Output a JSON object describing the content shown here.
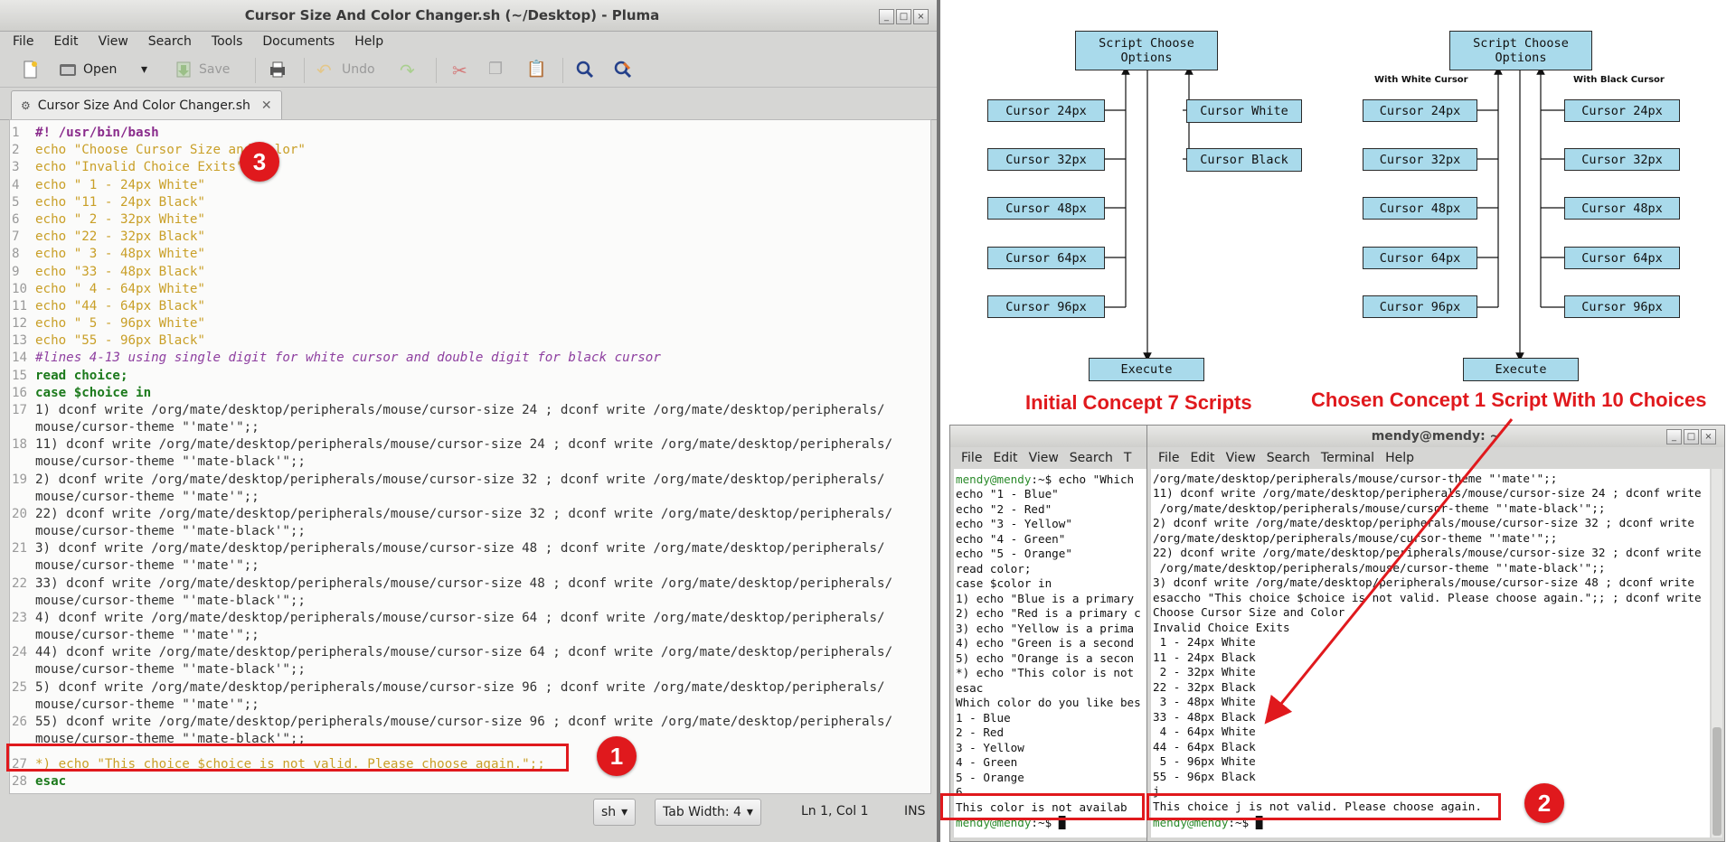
{
  "editor": {
    "title": "Cursor Size And Color Changer.sh (~/Desktop) - Pluma",
    "menu": [
      "File",
      "Edit",
      "View",
      "Search",
      "Tools",
      "Documents",
      "Help"
    ],
    "toolbar": {
      "open": "Open",
      "save": "Save",
      "undo": "Undo"
    },
    "tab_label": "Cursor Size And Color Changer.sh",
    "lines": [
      {
        "n": "1",
        "t": "#! /usr/bin/bash"
      },
      {
        "n": "2",
        "t": "echo \"Choose Cursor Size and Color\""
      },
      {
        "n": "3",
        "t": "echo \"Invalid Choice Exits\""
      },
      {
        "n": "4",
        "t": "echo \" 1 - 24px White\""
      },
      {
        "n": "5",
        "t": "echo \"11 - 24px Black\""
      },
      {
        "n": "6",
        "t": "echo \" 2 - 32px White\""
      },
      {
        "n": "7",
        "t": "echo \"22 - 32px Black\""
      },
      {
        "n": "8",
        "t": "echo \" 3 - 48px White\""
      },
      {
        "n": "9",
        "t": "echo \"33 - 48px Black\""
      },
      {
        "n": "10",
        "t": "echo \" 4 - 64px White\""
      },
      {
        "n": "11",
        "t": "echo \"44 - 64px Black\""
      },
      {
        "n": "12",
        "t": "echo \" 5 - 96px White\""
      },
      {
        "n": "13",
        "t": "echo \"55 - 96px Black\""
      },
      {
        "n": "14",
        "t": "#lines 4-13 using single digit for white cursor and double digit for black cursor"
      },
      {
        "n": "15",
        "t": "read choice;"
      },
      {
        "n": "16",
        "t": "case $choice in"
      },
      {
        "n": "17",
        "t": "1) dconf write /org/mate/desktop/peripherals/mouse/cursor-size 24 ; dconf write /org/mate/desktop/peripherals/",
        "t2": "mouse/cursor-theme \"'mate'\";;"
      },
      {
        "n": "18",
        "t": "11) dconf write /org/mate/desktop/peripherals/mouse/cursor-size 24 ; dconf write /org/mate/desktop/peripherals/",
        "t2": "mouse/cursor-theme \"'mate-black'\";;"
      },
      {
        "n": "19",
        "t": "2) dconf write /org/mate/desktop/peripherals/mouse/cursor-size 32 ; dconf write /org/mate/desktop/peripherals/",
        "t2": "mouse/cursor-theme \"'mate'\";;"
      },
      {
        "n": "20",
        "t": "22) dconf write /org/mate/desktop/peripherals/mouse/cursor-size 32 ; dconf write /org/mate/desktop/peripherals/",
        "t2": "mouse/cursor-theme \"'mate-black'\";;"
      },
      {
        "n": "21",
        "t": "3) dconf write /org/mate/desktop/peripherals/mouse/cursor-size 48 ; dconf write /org/mate/desktop/peripherals/",
        "t2": "mouse/cursor-theme \"'mate'\";;"
      },
      {
        "n": "22",
        "t": "33) dconf write /org/mate/desktop/peripherals/mouse/cursor-size 48 ; dconf write /org/mate/desktop/peripherals/",
        "t2": "mouse/cursor-theme \"'mate-black'\";;"
      },
      {
        "n": "23",
        "t": "4) dconf write /org/mate/desktop/peripherals/mouse/cursor-size 64 ; dconf write /org/mate/desktop/peripherals/",
        "t2": "mouse/cursor-theme \"'mate'\";;"
      },
      {
        "n": "24",
        "t": "44) dconf write /org/mate/desktop/peripherals/mouse/cursor-size 64 ; dconf write /org/mate/desktop/peripherals/",
        "t2": "mouse/cursor-theme \"'mate-black'\";;"
      },
      {
        "n": "25",
        "t": "5) dconf write /org/mate/desktop/peripherals/mouse/cursor-size 96 ; dconf write /org/mate/desktop/peripherals/",
        "t2": "mouse/cursor-theme \"'mate'\";;"
      },
      {
        "n": "26",
        "t": "55) dconf write /org/mate/desktop/peripherals/mouse/cursor-size 96 ; dconf write /org/mate/desktop/peripherals/",
        "t2": "mouse/cursor-theme \"'mate-black'\";;"
      },
      {
        "n": "27",
        "t": "*) echo \"This choice $choice is not valid. Please choose again.\";;"
      },
      {
        "n": "28",
        "t": "esac"
      }
    ],
    "status": {
      "lang": "sh",
      "tab_width": "Tab Width:  4",
      "position": "Ln 1, Col 1",
      "mode": "INS"
    }
  },
  "badges": {
    "one": "1",
    "two": "2",
    "three": "3"
  },
  "diagram": {
    "script_choose": "Script Choose Options",
    "execute": "Execute",
    "sizes": [
      "Cursor 24px",
      "Cursor 32px",
      "Cursor 48px",
      "Cursor 64px",
      "Cursor 96px"
    ],
    "colors": [
      "Cursor White",
      "Cursor Black"
    ],
    "with_white": "With White Cursor",
    "with_black": "With Black Cursor",
    "caption_left": "Initial Concept 7 Scripts",
    "caption_right": "Chosen Concept 1 Script With 10 Choices"
  },
  "term_left": {
    "menu": [
      "File",
      "Edit",
      "View",
      "Search",
      "T"
    ],
    "prompt_user": "mendy@mendy",
    "prompt_rest": ":~$ echo \"Which",
    "lines": [
      "echo \"1 - Blue\"",
      "echo \"2 - Red\"",
      "echo \"3 - Yellow\"",
      "echo \"4 - Green\"",
      "echo \"5 - Orange\"",
      "read color;",
      "case $color in",
      "1) echo \"Blue is a primary",
      "2) echo \"Red is a primary c",
      "3) echo \"Yellow is a prima",
      "4) echo \"Green is a second",
      "5) echo \"Orange is a secon",
      "*) echo \"This color is not",
      "esac",
      "Which color do you like bes",
      "1 - Blue",
      "2 - Red",
      "3 - Yellow",
      "4 - Green",
      "5 - Orange",
      "6"
    ],
    "highlight": "This color is not availab",
    "last_prompt_user": "mendy@mendy",
    "last_prompt_rest": ":~$ "
  },
  "term_right": {
    "title": "mendy@mendy: ~",
    "menu": [
      "File",
      "Edit",
      "View",
      "Search",
      "Terminal",
      "Help"
    ],
    "lines": [
      "/org/mate/desktop/peripherals/mouse/cursor-theme \"'mate'\";;",
      "11) dconf write /org/mate/desktop/peripherals/mouse/cursor-size 24 ; dconf write",
      " /org/mate/desktop/peripherals/mouse/cursor-theme \"'mate-black'\";;",
      "2) dconf write /org/mate/desktop/peripherals/mouse/cursor-size 32 ; dconf write",
      "/org/mate/desktop/peripherals/mouse/cursor-theme \"'mate'\";;",
      "22) dconf write /org/mate/desktop/peripherals/mouse/cursor-size 32 ; dconf write",
      " /org/mate/desktop/peripherals/mouse/cursor-theme \"'mate-black'\";;",
      "3) dconf write /org/mate/desktop/peripherals/mouse/cursor-size 48 ; dconf write",
      "esaccho \"This choice $choice is not valid. Please choose again.\";; ; dconf write",
      "Choose Cursor Size and Color",
      "Invalid Choice Exits",
      " 1 - 24px White",
      "11 - 24px Black",
      " 2 - 32px White",
      "22 - 32px Black",
      " 3 - 48px White",
      "33 - 48px Black",
      " 4 - 64px White",
      "44 - 64px Black",
      " 5 - 96px White",
      "55 - 96px Black",
      "j"
    ],
    "highlight": "This choice j is not valid. Please choose again.",
    "last_prompt_user": "mendy@mendy",
    "last_prompt_rest": ":~$ "
  },
  "colors": {
    "accent_red": "#e0191d",
    "box_fill": "#a9daeb",
    "keyword": "#1c7a1c",
    "string": "#c99f27",
    "comment": "#8e3fa0"
  }
}
